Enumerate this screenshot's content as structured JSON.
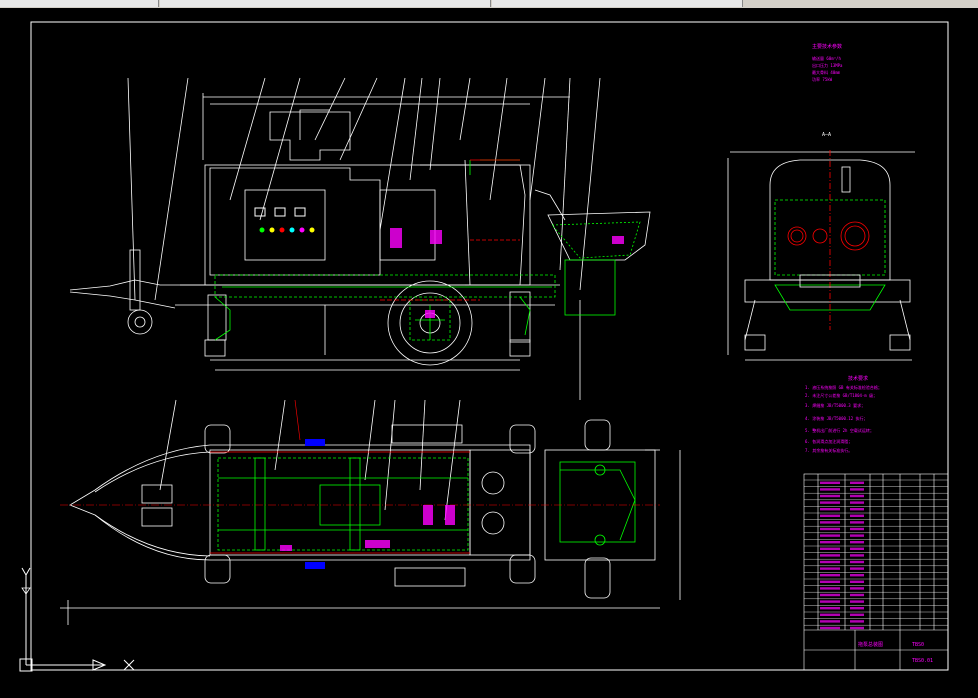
{
  "tech_params": {
    "title": "主要技术参数",
    "lines": [
      "输送量 60m³/h",
      "出口压力 13MPa",
      "最大骨料 40mm",
      "功率 75kW"
    ]
  },
  "section_label": "A—A",
  "tech_requirements": {
    "title": "技术要求",
    "lines": [
      "1.  液压系统按照 GB 有关标准检验合格；",
      "2.  未注尺寸公差按 GB/T1804-m 级；",
      "3.  焊缝按 JB/T5000.3 要求；",
      "4.  涂装按 JB/T5000.12 执行；",
      "5.  整机出厂前进行 2h 空载试运转；",
      "6.  各润滑点加注润滑脂；",
      "7.  其余按有关标准执行。"
    ]
  },
  "title_block": {
    "drawing_title": "拖泵总装图",
    "drawing_code": "TBS0",
    "sheet": "TBS0.01"
  },
  "colors": {
    "background": "#000000",
    "line": "#ffffff",
    "text": "#ff00ff",
    "hidden": "#00ff00",
    "centerline": "#ff0000",
    "dimension": "#ffff00",
    "cyan": "#00ffff",
    "blue": "#0000ff"
  },
  "icons": [
    "ucs-icon",
    "crosshair-icon"
  ]
}
